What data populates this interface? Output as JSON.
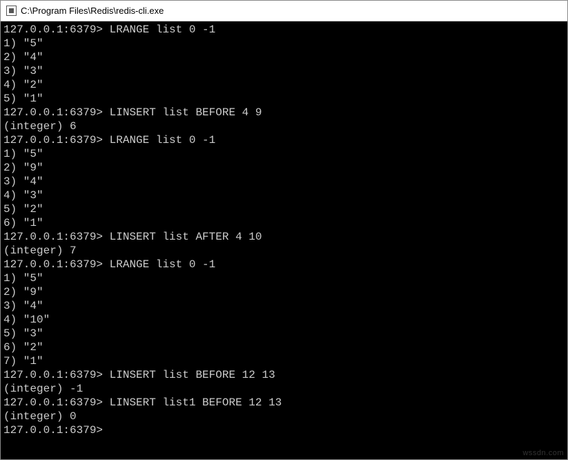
{
  "window": {
    "title": "C:\\Program Files\\Redis\\redis-cli.exe"
  },
  "prompt": "127.0.0.1:6379>",
  "session": [
    {
      "type": "cmd",
      "command": "LRANGE list 0 -1"
    },
    {
      "type": "out",
      "text": "1) \"5\""
    },
    {
      "type": "out",
      "text": "2) \"4\""
    },
    {
      "type": "out",
      "text": "3) \"3\""
    },
    {
      "type": "out",
      "text": "4) \"2\""
    },
    {
      "type": "out",
      "text": "5) \"1\""
    },
    {
      "type": "cmd",
      "command": "LINSERT list BEFORE 4 9"
    },
    {
      "type": "out",
      "text": "(integer) 6"
    },
    {
      "type": "cmd",
      "command": "LRANGE list 0 -1"
    },
    {
      "type": "out",
      "text": "1) \"5\""
    },
    {
      "type": "out",
      "text": "2) \"9\""
    },
    {
      "type": "out",
      "text": "3) \"4\""
    },
    {
      "type": "out",
      "text": "4) \"3\""
    },
    {
      "type": "out",
      "text": "5) \"2\""
    },
    {
      "type": "out",
      "text": "6) \"1\""
    },
    {
      "type": "cmd",
      "command": "LINSERT list AFTER 4 10"
    },
    {
      "type": "out",
      "text": "(integer) 7"
    },
    {
      "type": "cmd",
      "command": "LRANGE list 0 -1"
    },
    {
      "type": "out",
      "text": "1) \"5\""
    },
    {
      "type": "out",
      "text": "2) \"9\""
    },
    {
      "type": "out",
      "text": "3) \"4\""
    },
    {
      "type": "out",
      "text": "4) \"10\""
    },
    {
      "type": "out",
      "text": "5) \"3\""
    },
    {
      "type": "out",
      "text": "6) \"2\""
    },
    {
      "type": "out",
      "text": "7) \"1\""
    },
    {
      "type": "cmd",
      "command": "LINSERT list BEFORE 12 13"
    },
    {
      "type": "out",
      "text": "(integer) -1"
    },
    {
      "type": "cmd",
      "command": "LINSERT list1 BEFORE 12 13"
    },
    {
      "type": "out",
      "text": "(integer) 0"
    },
    {
      "type": "cmd",
      "command": ""
    }
  ],
  "watermark": "wssdn.com"
}
